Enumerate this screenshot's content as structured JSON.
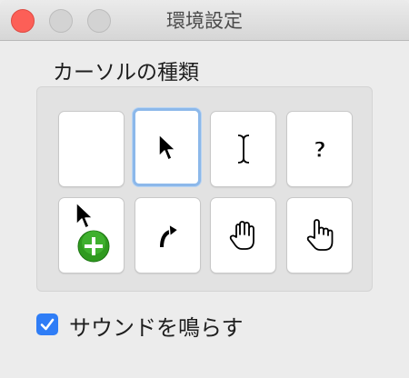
{
  "window": {
    "title": "環境設定"
  },
  "cursor_section": {
    "label": "カーソルの種類",
    "options": [
      {
        "icon": "blank-cursor-icon",
        "selected": false
      },
      {
        "icon": "arrow-cursor-icon",
        "selected": true
      },
      {
        "icon": "ibeam-cursor-icon",
        "selected": false
      },
      {
        "icon": "help-cursor-icon",
        "selected": false
      },
      {
        "icon": "copy-cursor-icon",
        "selected": false
      },
      {
        "icon": "alias-cursor-icon",
        "selected": false
      },
      {
        "icon": "open-hand-cursor-icon",
        "selected": false
      },
      {
        "icon": "pointing-hand-cursor-icon",
        "selected": false
      }
    ]
  },
  "sound": {
    "label": "サウンドを鳴らす",
    "checked": true
  },
  "colors": {
    "accent": "#2f7df6",
    "selection_ring": "#8cb8ea",
    "close_button": "#fc5f57"
  }
}
